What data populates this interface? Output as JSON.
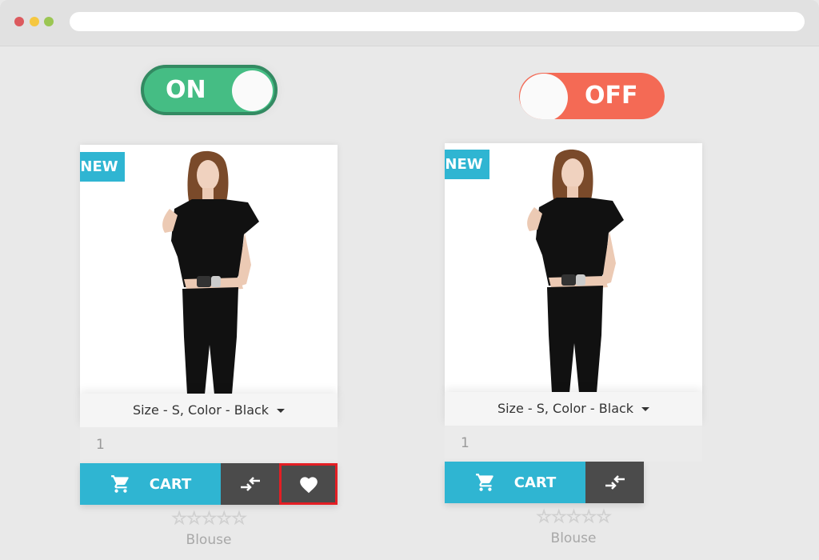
{
  "browser": {
    "window_controls": [
      "close",
      "minimize",
      "maximize"
    ],
    "address": ""
  },
  "toggles": [
    {
      "label": "ON",
      "state": true,
      "color": "#45bd84"
    },
    {
      "label": "OFF",
      "state": false,
      "color": "#f46a55"
    }
  ],
  "products": [
    {
      "badge": "NEW",
      "variant": "Size - S, Color - Black",
      "quantity": "1",
      "cart_label": "CART",
      "icons": {
        "cart": "shopping-cart-icon",
        "compare": "compare-arrows-icon",
        "wishlist": "heart-icon"
      },
      "has_wishlist": true,
      "wishlist_highlighted": true,
      "rating": 0,
      "rating_max": 5,
      "stars": "☆☆☆☆☆",
      "name": "Blouse"
    },
    {
      "badge": "NEW",
      "variant": "Size - S, Color - Black",
      "quantity": "1",
      "cart_label": "CART",
      "icons": {
        "cart": "shopping-cart-icon",
        "compare": "compare-arrows-icon"
      },
      "has_wishlist": false,
      "rating": 0,
      "rating_max": 5,
      "stars": "☆☆☆☆☆",
      "name": "Blouse"
    }
  ],
  "colors": {
    "accent": "#2fb5d2",
    "dark_button": "#4b4b4b",
    "highlight": "#e31e24"
  }
}
